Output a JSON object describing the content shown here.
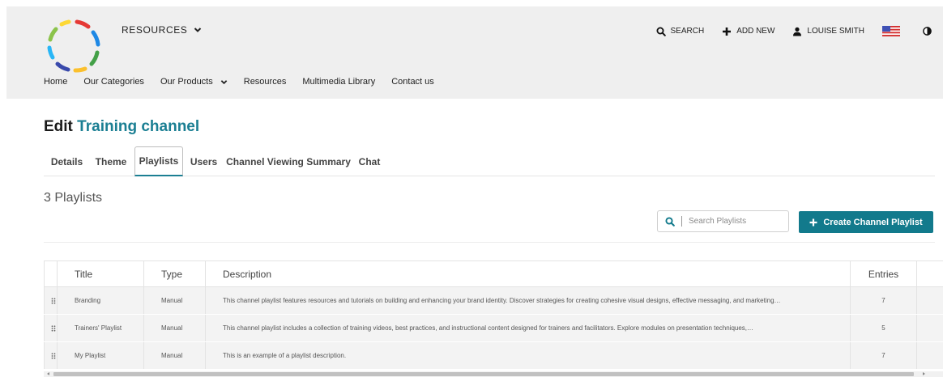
{
  "header": {
    "resources_label": "RESOURCES",
    "topbar": {
      "search_label": "SEARCH",
      "add_new_label": "ADD NEW",
      "user_label": "LOUISE SMITH"
    },
    "nav": [
      {
        "label": "Home"
      },
      {
        "label": "Our Categories"
      },
      {
        "label": "Our Products"
      },
      {
        "label": "Resources"
      },
      {
        "label": "Multimedia Library"
      },
      {
        "label": "Contact us"
      }
    ]
  },
  "page": {
    "title_prefix": "Edit",
    "title_name": "Training channel",
    "tabs": [
      {
        "label": "Details"
      },
      {
        "label": "Theme"
      },
      {
        "label": "Playlists"
      },
      {
        "label": "Users"
      },
      {
        "label": "Channel Viewing Summary"
      },
      {
        "label": "Chat"
      }
    ],
    "active_tab": "Playlists",
    "playlist_count": "3 Playlists",
    "search_placeholder": "Search Playlists",
    "create_label": "Create Channel Playlist"
  },
  "table": {
    "columns": [
      "Title",
      "Type",
      "Description",
      "Entries"
    ],
    "rows": [
      {
        "title": "Branding",
        "type": "Manual",
        "description": "This channel playlist features resources and tutorials on building and enhancing your brand identity. Discover strategies for creating cohesive visual designs, effective messaging, and marketing…",
        "entries": "7"
      },
      {
        "title": "Trainers' Playlist",
        "type": "Manual",
        "description": "This channel playlist includes a collection of training videos, best practices, and instructional content designed for trainers and facilitators. Explore modules on presentation techniques,…",
        "entries": "5"
      },
      {
        "title": "My Playlist",
        "type": "Manual",
        "description": "This is an example of a playlist description.",
        "entries": "7"
      }
    ]
  },
  "colors": {
    "accent": "#1b7f93",
    "button": "#127a8c",
    "header_bg": "#efefef"
  },
  "icons": {
    "logo": "dashed-color-circle-logo",
    "search": "magnifier-icon",
    "add": "plus-icon",
    "user": "user-icon",
    "flag": "us-flag-icon",
    "contrast": "contrast-icon",
    "grip": "drag-handle-icon"
  }
}
